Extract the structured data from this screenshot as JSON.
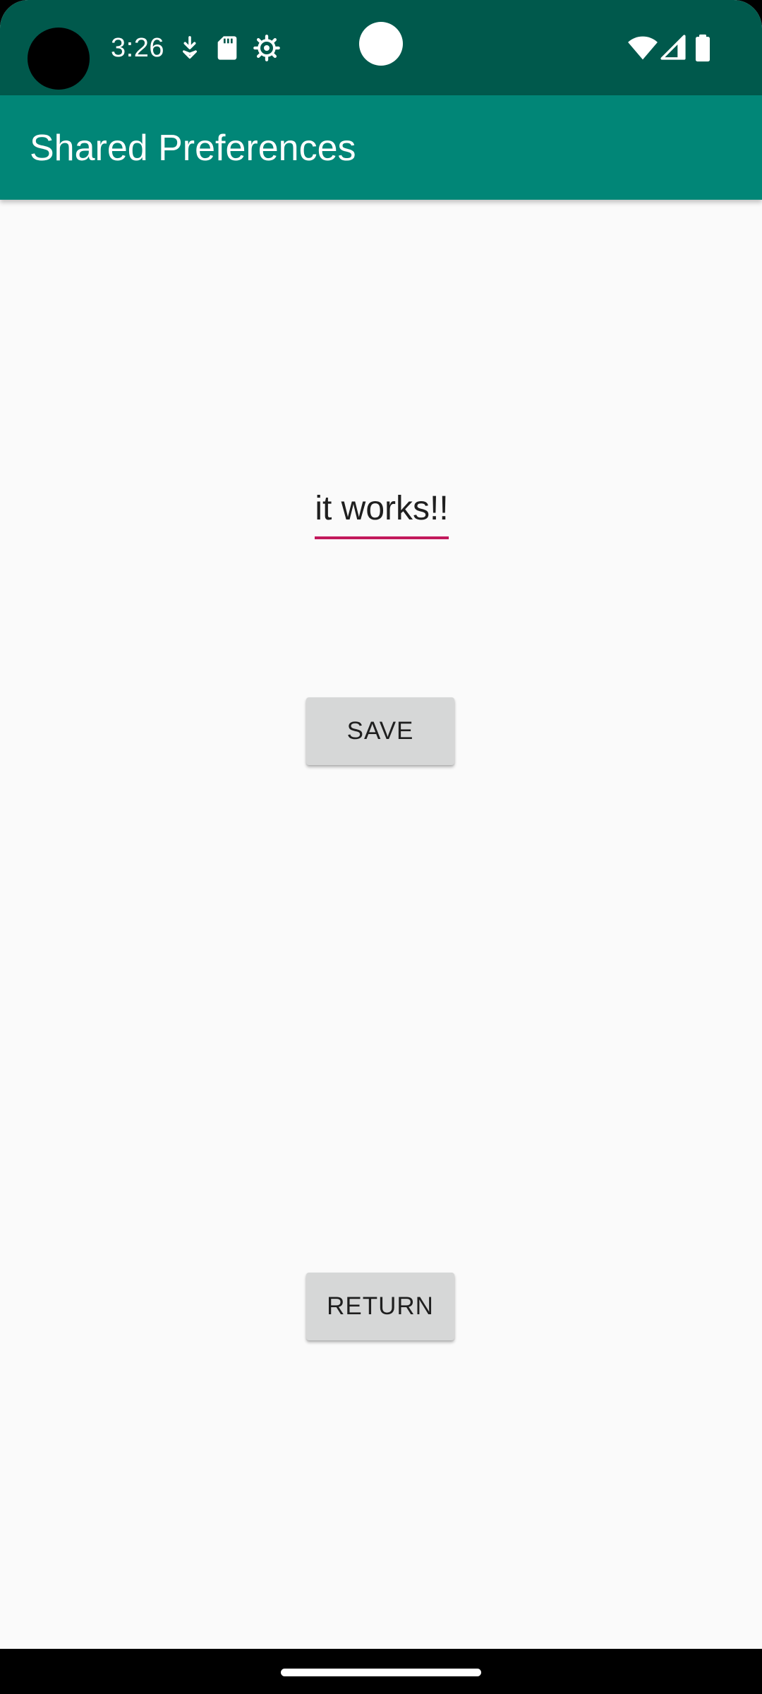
{
  "status_bar": {
    "time": "3:26",
    "left_icons": [
      "download-icon",
      "sd-card-icon",
      "gear-icon"
    ],
    "right_icons": [
      "wifi-icon",
      "cell-signal-icon",
      "battery-icon"
    ],
    "background": "#00594c"
  },
  "app_bar": {
    "title": "Shared Preferences",
    "background": "#018677"
  },
  "main": {
    "edit_text": {
      "value": "it works!!",
      "underline_color": "#c2185b"
    },
    "save_button": {
      "label": "SAVE"
    },
    "return_button": {
      "label": "RETURN"
    }
  }
}
